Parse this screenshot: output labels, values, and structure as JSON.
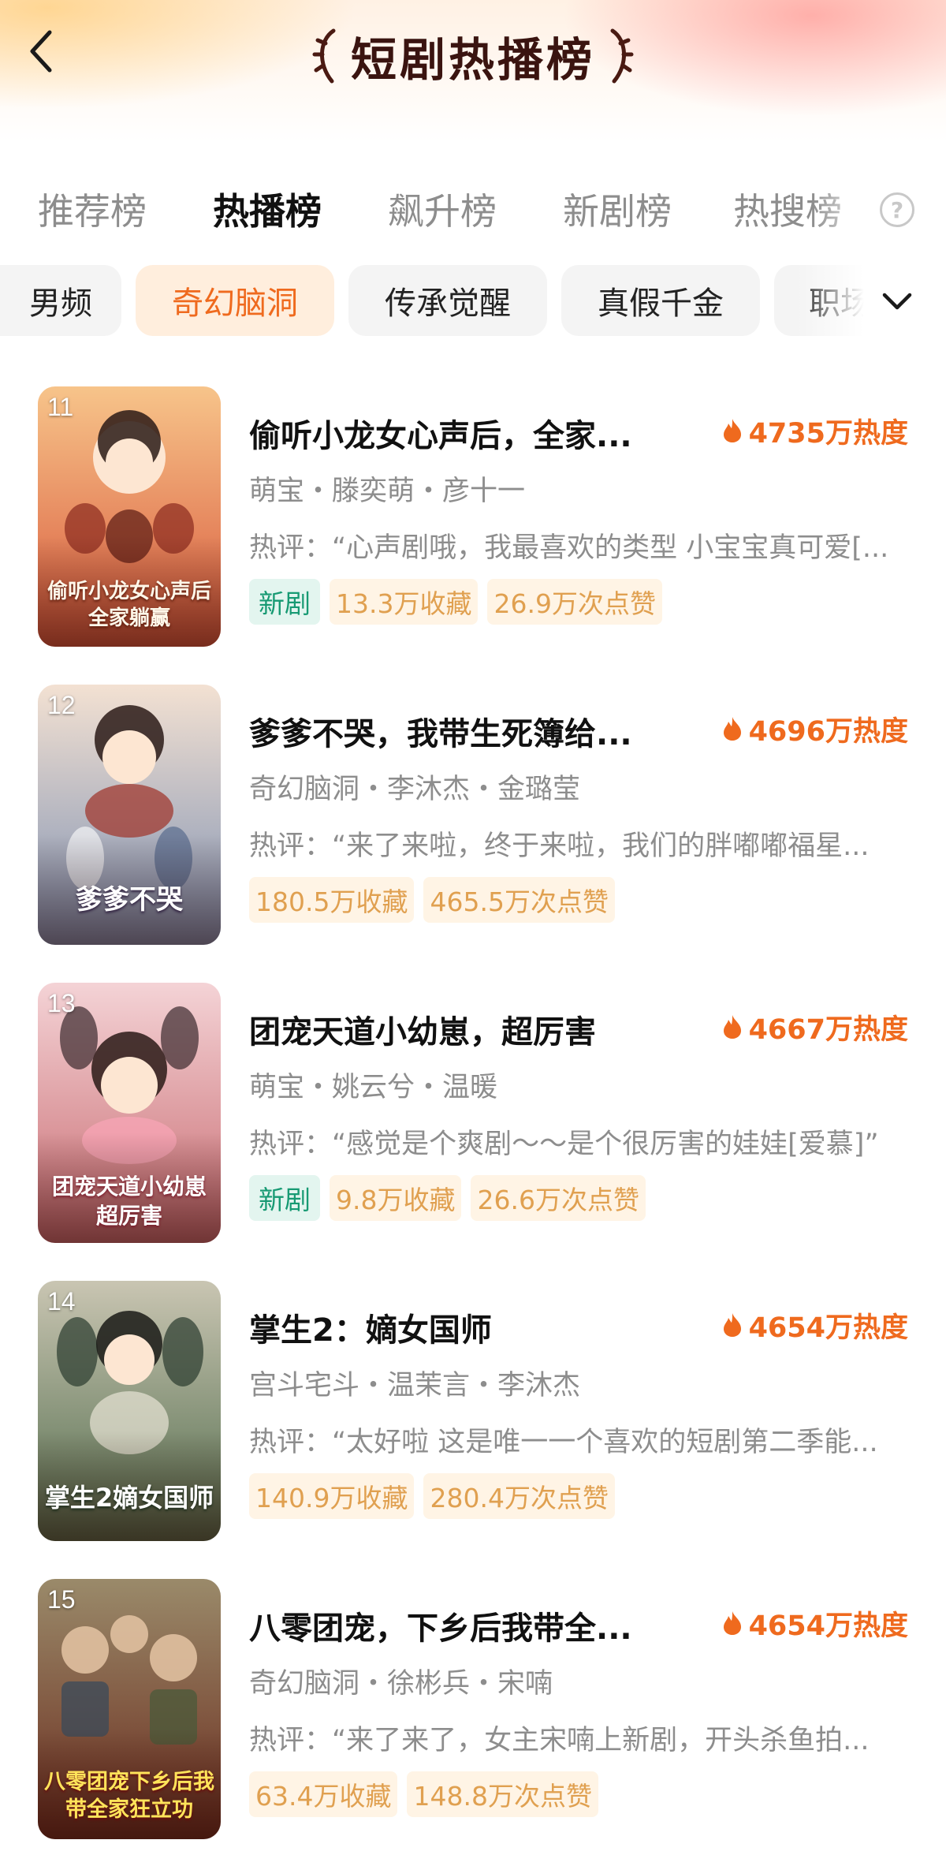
{
  "header": {
    "title": "短剧热播榜"
  },
  "main_tabs": [
    {
      "label": "推荐榜"
    },
    {
      "label": "热播榜"
    },
    {
      "label": "飙升榜"
    },
    {
      "label": "新剧榜"
    },
    {
      "label": "热搜榜"
    }
  ],
  "help_icon_text": "?",
  "category_chips": [
    {
      "label": "男频"
    },
    {
      "label": "奇幻脑洞"
    },
    {
      "label": "传承觉醒"
    },
    {
      "label": "真假千金"
    },
    {
      "label": "职场"
    }
  ],
  "items": [
    {
      "rank": "11",
      "title": "偷听小龙女心声后，全家...",
      "heat": "4735万热度",
      "meta": "萌宝・滕奕萌・彦十一",
      "comment": "热评：“心声剧哦，我最喜欢的类型 小宝宝真可爱[...",
      "new_tag": "新剧",
      "favorites": "13.3万收藏",
      "likes": "26.9万次点赞",
      "poster_title": "偷听小龙女心声后全家躺赢",
      "poster_colors": [
        "#f7c48a",
        "#d8563a"
      ]
    },
    {
      "rank": "12",
      "title": "爹爹不哭，我带生死簿给...",
      "heat": "4696万热度",
      "meta": "奇幻脑洞・李沐杰・金璐莹",
      "comment": "热评：“来了来啦，终于来啦，我们的胖嘟嘟福星...",
      "favorites": "180.5万收藏",
      "likes": "465.5万次点赞",
      "poster_title": "爹爹不哭",
      "poster_colors": [
        "#f3e1d2",
        "#7c8fb1"
      ]
    },
    {
      "rank": "13",
      "title": "团宠天道小幼崽，超厉害",
      "heat": "4667万热度",
      "meta": "萌宝・姚云兮・温暖",
      "comment": "热评：“感觉是个爽剧～～是个很厉害的娃娃[爱慕]”",
      "new_tag": "新剧",
      "favorites": "9.8万收藏",
      "likes": "26.6万次点赞",
      "poster_title": "团宠天道小幼崽超厉害",
      "poster_colors": [
        "#f4d3d6",
        "#c8696f"
      ]
    },
    {
      "rank": "14",
      "title": "掌生2：嫡女国师",
      "heat": "4654万热度",
      "meta": "宫斗宅斗・温茉言・李沐杰",
      "comment": "热评：“太好啦 这是唯一一个喜欢的短剧第二季能...",
      "favorites": "140.9万收藏",
      "likes": "280.4万次点赞",
      "poster_title": "掌生2嫡女国师",
      "poster_colors": [
        "#c9c5b2",
        "#4f6a4a"
      ]
    },
    {
      "rank": "15",
      "title": "八零团宠，下乡后我带全...",
      "heat": "4654万热度",
      "meta": "奇幻脑洞・徐彬兵・宋喃",
      "comment": "热评：“来了来了，女主宋喃上新剧，开头杀鱼拍...",
      "favorites": "63.4万收藏",
      "likes": "148.8万次点赞",
      "poster_title": "八零团宠下乡后我带全家狂立功",
      "poster_colors": [
        "#9a8a6a",
        "#6a2a1c"
      ]
    }
  ]
}
